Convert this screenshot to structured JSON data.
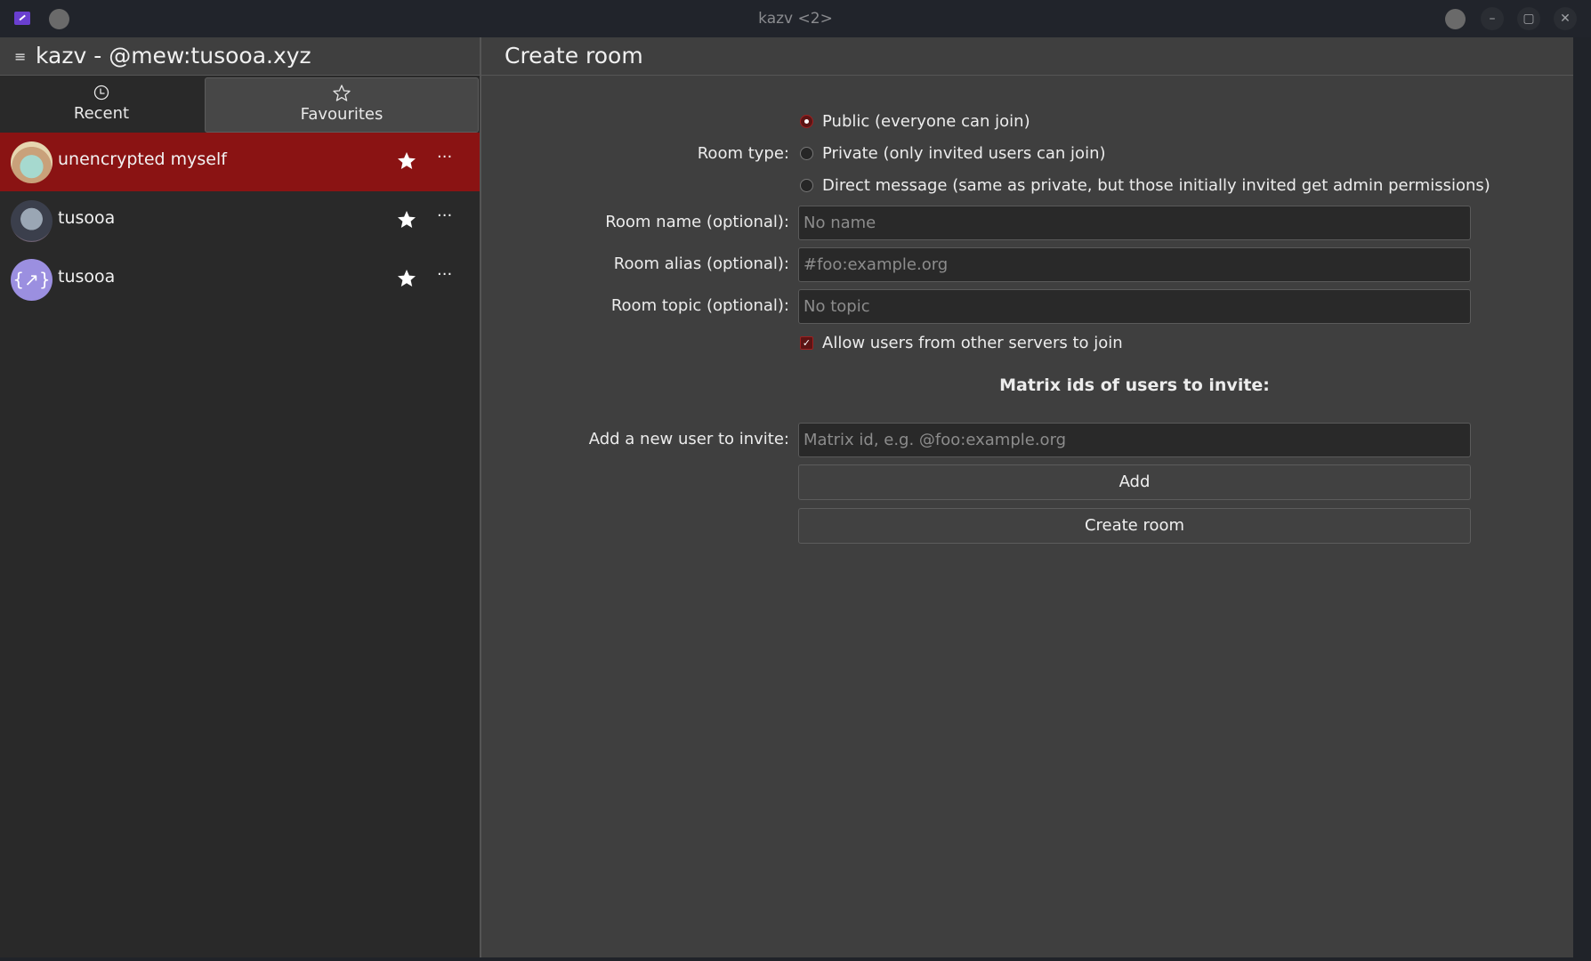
{
  "window": {
    "title": "kazv <2>",
    "controls": {
      "minimize": "–",
      "maximize": "▢",
      "close": "✕"
    }
  },
  "sidebar": {
    "title": "kazv - @mew:tusooa.xyz",
    "menu_icon": "≡",
    "tabs": [
      {
        "label": "Recent",
        "icon": "clock-icon",
        "active": false
      },
      {
        "label": "Favourites",
        "icon": "star-outline-icon",
        "active": true
      }
    ],
    "rooms": [
      {
        "name": "unencrypted myself",
        "selected": true,
        "favourite": true,
        "more": "···"
      },
      {
        "name": "tusooa",
        "selected": false,
        "favourite": true,
        "more": "···"
      },
      {
        "name": "tusooa",
        "selected": false,
        "favourite": true,
        "more": "···"
      }
    ]
  },
  "main": {
    "title": "Create room",
    "room_type_label": "Room type:",
    "room_type_options": [
      {
        "label": "Public (everyone can join)",
        "checked": true
      },
      {
        "label": "Private (only invited users can join)",
        "checked": false
      },
      {
        "label": "Direct message (same as private, but those initially invited get admin permissions)",
        "checked": false
      }
    ],
    "room_name": {
      "label": "Room name (optional):",
      "value": "",
      "placeholder": "No name"
    },
    "room_alias": {
      "label": "Room alias (optional):",
      "value": "",
      "placeholder": "#foo:example.org"
    },
    "room_topic": {
      "label": "Room topic (optional):",
      "value": "",
      "placeholder": "No topic"
    },
    "allow_federation": {
      "label": "Allow users from other servers to join",
      "checked": true
    },
    "invite_section_title": "Matrix ids of users to invite:",
    "invite_input": {
      "label": "Add a new user to invite:",
      "value": "",
      "placeholder": "Matrix id, e.g. @foo:example.org"
    },
    "add_button": "Add",
    "create_button": "Create room"
  },
  "colors": {
    "accent": "#8a1313",
    "background": "#3f3f3f",
    "sidebar_bg": "#292929",
    "titlebar_bg": "#21242b"
  }
}
